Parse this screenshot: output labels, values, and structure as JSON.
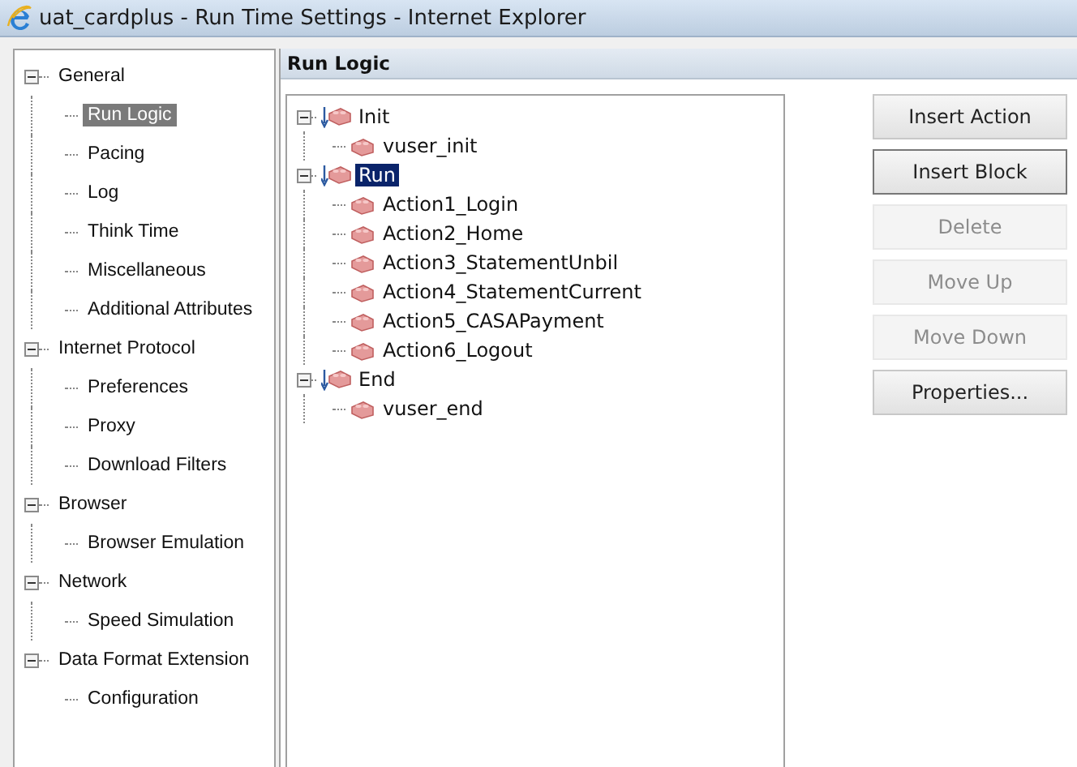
{
  "window": {
    "title": "uat_cardplus - Run Time Settings - Internet Explorer"
  },
  "sidebar": {
    "items": [
      {
        "label": "General",
        "expanded": true,
        "selected": false,
        "children": [
          {
            "label": "Run Logic",
            "selected": true
          },
          {
            "label": "Pacing",
            "selected": false
          },
          {
            "label": "Log",
            "selected": false
          },
          {
            "label": "Think Time",
            "selected": false
          },
          {
            "label": "Miscellaneous",
            "selected": false
          },
          {
            "label": "Additional Attributes",
            "selected": false
          }
        ]
      },
      {
        "label": "Internet Protocol",
        "expanded": true,
        "selected": false,
        "children": [
          {
            "label": "Preferences",
            "selected": false
          },
          {
            "label": "Proxy",
            "selected": false
          },
          {
            "label": "Download Filters",
            "selected": false
          }
        ]
      },
      {
        "label": "Browser",
        "expanded": true,
        "selected": false,
        "children": [
          {
            "label": "Browser Emulation",
            "selected": false
          }
        ]
      },
      {
        "label": "Network",
        "expanded": true,
        "selected": false,
        "children": [
          {
            "label": "Speed Simulation",
            "selected": false
          }
        ]
      },
      {
        "label": "Data Format Extension",
        "expanded": true,
        "selected": false,
        "children": [
          {
            "label": "Configuration",
            "selected": false
          }
        ]
      }
    ]
  },
  "panel": {
    "title": "Run Logic"
  },
  "run_logic_tree": [
    {
      "label": "Init",
      "kind": "block",
      "expanded": true,
      "selected": false,
      "children": [
        {
          "label": "vuser_init",
          "kind": "action",
          "selected": false
        }
      ]
    },
    {
      "label": "Run",
      "kind": "block",
      "expanded": true,
      "selected": true,
      "children": [
        {
          "label": "Action1_Login",
          "kind": "action",
          "selected": false
        },
        {
          "label": "Action2_Home",
          "kind": "action",
          "selected": false
        },
        {
          "label": "Action3_StatementUnbil",
          "kind": "action",
          "selected": false
        },
        {
          "label": "Action4_StatementCurrent",
          "kind": "action",
          "selected": false
        },
        {
          "label": "Action5_CASAPayment",
          "kind": "action",
          "selected": false
        },
        {
          "label": "Action6_Logout",
          "kind": "action",
          "selected": false
        }
      ]
    },
    {
      "label": "End",
      "kind": "block",
      "expanded": true,
      "selected": false,
      "children": [
        {
          "label": "vuser_end",
          "kind": "action",
          "selected": false
        }
      ]
    }
  ],
  "buttons": [
    {
      "label": "Insert Action",
      "disabled": false,
      "focused": false
    },
    {
      "label": "Insert Block",
      "disabled": false,
      "focused": true
    },
    {
      "label": "Delete",
      "disabled": true,
      "focused": false
    },
    {
      "label": "Move Up",
      "disabled": true,
      "focused": false
    },
    {
      "label": "Move Down",
      "disabled": true,
      "focused": false
    },
    {
      "label": "Properties...",
      "disabled": false,
      "focused": false
    }
  ]
}
